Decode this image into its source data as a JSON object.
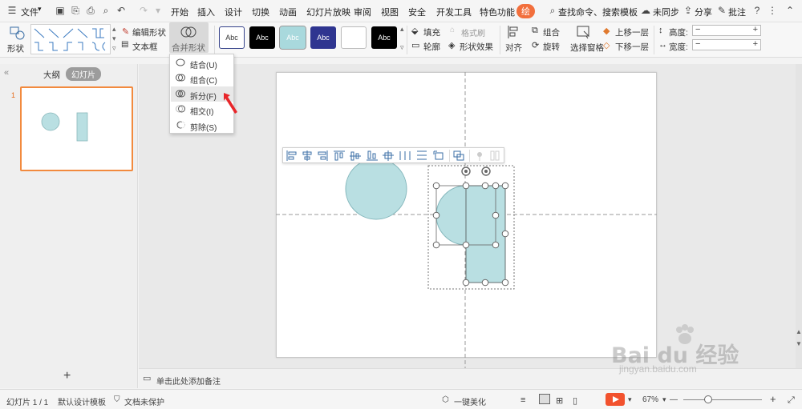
{
  "menubar": {
    "file": "文件",
    "tabs": [
      "开始",
      "插入",
      "设计",
      "切换",
      "动画",
      "幻灯片放映",
      "审阅",
      "视图",
      "安全",
      "开发工具",
      "特色功能"
    ],
    "accent_tab": "绘",
    "search": "查找命令、搜索模板",
    "sync": "未同步",
    "share": "分享",
    "comment": "批注"
  },
  "ribbon": {
    "shape_label": "形状",
    "edit_shape": "编辑形状",
    "text_box": "文本框",
    "merge_shape": "合并形状",
    "style_samples": [
      "Abc",
      "Abc",
      "Abc",
      "Abc",
      "",
      "Abc"
    ],
    "fill": "填充",
    "format_painter": "格式刷",
    "outline": "轮廓",
    "shape_effect": "形状效果",
    "align": "对齐",
    "group": "组合",
    "rotate": "旋转",
    "selection_pane": "选择窗格",
    "bring_forward": "上移一层",
    "send_backward": "下移一层",
    "height_label": "高度:",
    "width_label": "宽度:",
    "minus": "−",
    "plus": "+"
  },
  "dropdown": {
    "items": [
      "结合(U)",
      "组合(C)",
      "拆分(F)",
      "相交(I)",
      "剪除(S)"
    ]
  },
  "leftpane": {
    "outline_tab": "大纲",
    "slides_tab": "幻灯片",
    "slide_number": "1",
    "add_slide": "+"
  },
  "notes": {
    "placeholder": "单击此处添加备注"
  },
  "statusbar": {
    "slide_info": "幻灯片 1 / 1",
    "template": "默认设计模板",
    "protect": "文档未保护",
    "beautify": "一键美化",
    "zoom": "67%",
    "minus": "—",
    "plus": "+"
  },
  "watermark": {
    "brand": "Bai du 经验",
    "url": "jingyan.baidu.com"
  },
  "colors": {
    "shape_fill": "#b9dfe2",
    "accent": "#f26f3c",
    "thumb_border": "#f28a3e",
    "play_button": "#f2522e",
    "arrow": "#e8262a"
  },
  "icons": [
    "menu-icon",
    "save-icon",
    "undo-icon",
    "redo-icon",
    "search-icon",
    "cloud-icon",
    "share-icon",
    "comment-icon",
    "help-icon",
    "more-icon",
    "play-icon"
  ]
}
